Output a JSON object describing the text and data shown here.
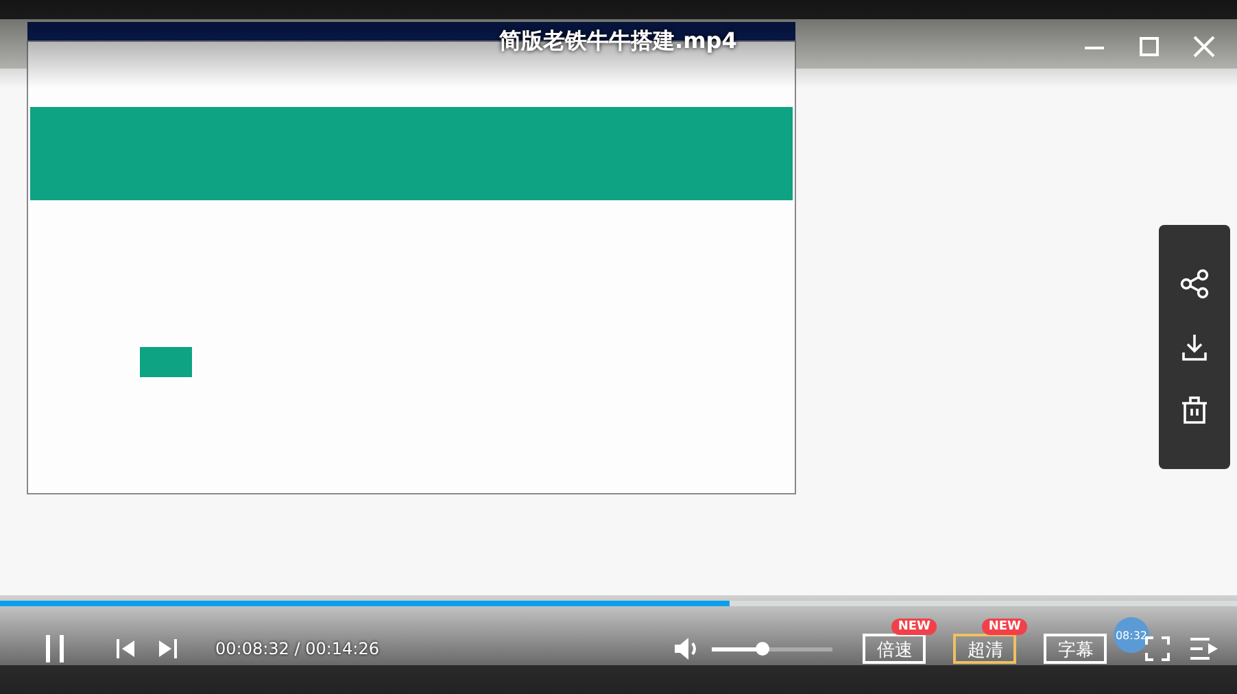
{
  "title": "简版老铁牛牛搭建.mp4",
  "progress": {
    "level": 0.59
  },
  "playing": true,
  "time": "00:08:32 / 00:14:26",
  "preview_time": "08:32",
  "volume": {
    "level": 0.42
  },
  "buttons": [
    {
      "label": "倍速",
      "badge": "NEW",
      "selected": false
    },
    {
      "label": "超清",
      "badge": "NEW",
      "selected": true
    },
    {
      "label": "字幕",
      "selected": false
    }
  ]
}
